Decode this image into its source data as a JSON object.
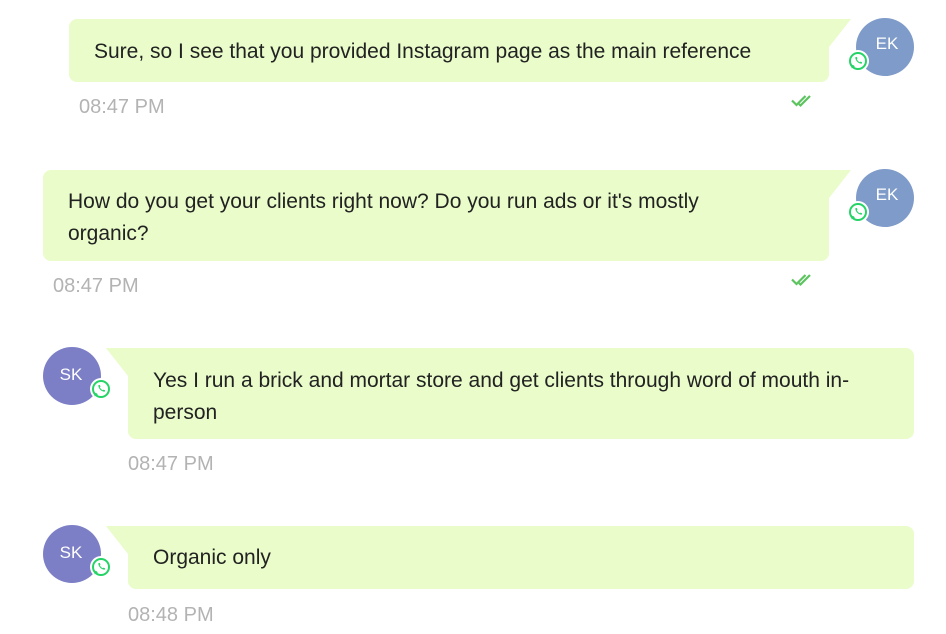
{
  "messages": [
    {
      "sender": "EK",
      "direction": "outgoing",
      "text": "Sure, so I see that you provided Instagram page as the main reference",
      "time": "08:47 PM",
      "status": "read"
    },
    {
      "sender": "EK",
      "direction": "outgoing",
      "text": "How do you get your clients right now? Do you run ads or it's mostly organic?",
      "time": "08:47 PM",
      "status": "read"
    },
    {
      "sender": "SK",
      "direction": "incoming",
      "text": "Yes I run a brick and mortar store and get clients through word of mouth in-person",
      "time": "08:47 PM"
    },
    {
      "sender": "SK",
      "direction": "incoming",
      "text": "Organic only",
      "time": "08:48 PM"
    }
  ],
  "colors": {
    "bubble": "#e9fcca",
    "avatar_ek": "#7f9bc9",
    "avatar_sk": "#7d7fc6",
    "timestamp": "#b3b3b3",
    "check": "#5cc45e",
    "whatsapp": "#25d366"
  },
  "icons": {
    "channel": "whatsapp-icon",
    "status": "double-check-icon"
  }
}
